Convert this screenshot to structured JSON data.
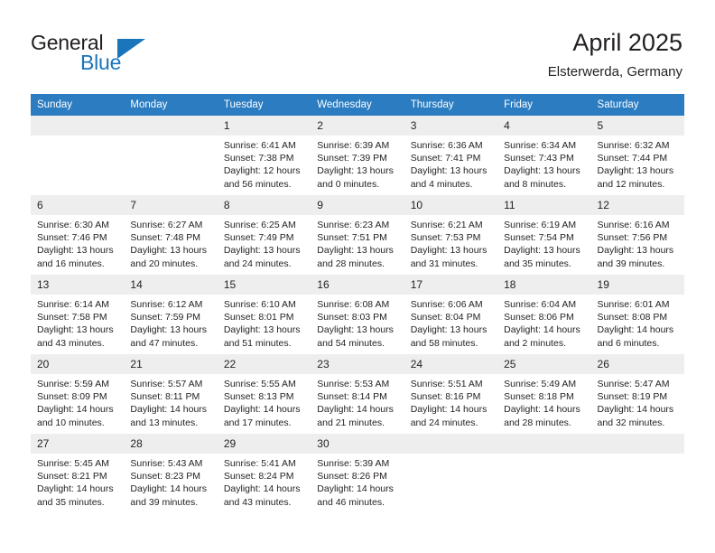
{
  "brand": {
    "word1": "General",
    "word2": "Blue",
    "logo_icon": "triangle-logo-icon",
    "accent_color": "#1b75bb"
  },
  "header": {
    "title": "April 2025",
    "subtitle": "Elsterwerda, Germany"
  },
  "calendar": {
    "header_bg": "#2b7cc1",
    "row_divider_color": "#2b6cb0",
    "daynum_bg": "#eeeeee",
    "weekday_headers": [
      "Sunday",
      "Monday",
      "Tuesday",
      "Wednesday",
      "Thursday",
      "Friday",
      "Saturday"
    ],
    "weeks": [
      [
        {
          "day": "",
          "sunrise": "",
          "sunset": "",
          "daylight_line1": "",
          "daylight_line2": ""
        },
        {
          "day": "",
          "sunrise": "",
          "sunset": "",
          "daylight_line1": "",
          "daylight_line2": ""
        },
        {
          "day": "1",
          "sunrise": "Sunrise: 6:41 AM",
          "sunset": "Sunset: 7:38 PM",
          "daylight_line1": "Daylight: 12 hours",
          "daylight_line2": "and 56 minutes."
        },
        {
          "day": "2",
          "sunrise": "Sunrise: 6:39 AM",
          "sunset": "Sunset: 7:39 PM",
          "daylight_line1": "Daylight: 13 hours",
          "daylight_line2": "and 0 minutes."
        },
        {
          "day": "3",
          "sunrise": "Sunrise: 6:36 AM",
          "sunset": "Sunset: 7:41 PM",
          "daylight_line1": "Daylight: 13 hours",
          "daylight_line2": "and 4 minutes."
        },
        {
          "day": "4",
          "sunrise": "Sunrise: 6:34 AM",
          "sunset": "Sunset: 7:43 PM",
          "daylight_line1": "Daylight: 13 hours",
          "daylight_line2": "and 8 minutes."
        },
        {
          "day": "5",
          "sunrise": "Sunrise: 6:32 AM",
          "sunset": "Sunset: 7:44 PM",
          "daylight_line1": "Daylight: 13 hours",
          "daylight_line2": "and 12 minutes."
        }
      ],
      [
        {
          "day": "6",
          "sunrise": "Sunrise: 6:30 AM",
          "sunset": "Sunset: 7:46 PM",
          "daylight_line1": "Daylight: 13 hours",
          "daylight_line2": "and 16 minutes."
        },
        {
          "day": "7",
          "sunrise": "Sunrise: 6:27 AM",
          "sunset": "Sunset: 7:48 PM",
          "daylight_line1": "Daylight: 13 hours",
          "daylight_line2": "and 20 minutes."
        },
        {
          "day": "8",
          "sunrise": "Sunrise: 6:25 AM",
          "sunset": "Sunset: 7:49 PM",
          "daylight_line1": "Daylight: 13 hours",
          "daylight_line2": "and 24 minutes."
        },
        {
          "day": "9",
          "sunrise": "Sunrise: 6:23 AM",
          "sunset": "Sunset: 7:51 PM",
          "daylight_line1": "Daylight: 13 hours",
          "daylight_line2": "and 28 minutes."
        },
        {
          "day": "10",
          "sunrise": "Sunrise: 6:21 AM",
          "sunset": "Sunset: 7:53 PM",
          "daylight_line1": "Daylight: 13 hours",
          "daylight_line2": "and 31 minutes."
        },
        {
          "day": "11",
          "sunrise": "Sunrise: 6:19 AM",
          "sunset": "Sunset: 7:54 PM",
          "daylight_line1": "Daylight: 13 hours",
          "daylight_line2": "and 35 minutes."
        },
        {
          "day": "12",
          "sunrise": "Sunrise: 6:16 AM",
          "sunset": "Sunset: 7:56 PM",
          "daylight_line1": "Daylight: 13 hours",
          "daylight_line2": "and 39 minutes."
        }
      ],
      [
        {
          "day": "13",
          "sunrise": "Sunrise: 6:14 AM",
          "sunset": "Sunset: 7:58 PM",
          "daylight_line1": "Daylight: 13 hours",
          "daylight_line2": "and 43 minutes."
        },
        {
          "day": "14",
          "sunrise": "Sunrise: 6:12 AM",
          "sunset": "Sunset: 7:59 PM",
          "daylight_line1": "Daylight: 13 hours",
          "daylight_line2": "and 47 minutes."
        },
        {
          "day": "15",
          "sunrise": "Sunrise: 6:10 AM",
          "sunset": "Sunset: 8:01 PM",
          "daylight_line1": "Daylight: 13 hours",
          "daylight_line2": "and 51 minutes."
        },
        {
          "day": "16",
          "sunrise": "Sunrise: 6:08 AM",
          "sunset": "Sunset: 8:03 PM",
          "daylight_line1": "Daylight: 13 hours",
          "daylight_line2": "and 54 minutes."
        },
        {
          "day": "17",
          "sunrise": "Sunrise: 6:06 AM",
          "sunset": "Sunset: 8:04 PM",
          "daylight_line1": "Daylight: 13 hours",
          "daylight_line2": "and 58 minutes."
        },
        {
          "day": "18",
          "sunrise": "Sunrise: 6:04 AM",
          "sunset": "Sunset: 8:06 PM",
          "daylight_line1": "Daylight: 14 hours",
          "daylight_line2": "and 2 minutes."
        },
        {
          "day": "19",
          "sunrise": "Sunrise: 6:01 AM",
          "sunset": "Sunset: 8:08 PM",
          "daylight_line1": "Daylight: 14 hours",
          "daylight_line2": "and 6 minutes."
        }
      ],
      [
        {
          "day": "20",
          "sunrise": "Sunrise: 5:59 AM",
          "sunset": "Sunset: 8:09 PM",
          "daylight_line1": "Daylight: 14 hours",
          "daylight_line2": "and 10 minutes."
        },
        {
          "day": "21",
          "sunrise": "Sunrise: 5:57 AM",
          "sunset": "Sunset: 8:11 PM",
          "daylight_line1": "Daylight: 14 hours",
          "daylight_line2": "and 13 minutes."
        },
        {
          "day": "22",
          "sunrise": "Sunrise: 5:55 AM",
          "sunset": "Sunset: 8:13 PM",
          "daylight_line1": "Daylight: 14 hours",
          "daylight_line2": "and 17 minutes."
        },
        {
          "day": "23",
          "sunrise": "Sunrise: 5:53 AM",
          "sunset": "Sunset: 8:14 PM",
          "daylight_line1": "Daylight: 14 hours",
          "daylight_line2": "and 21 minutes."
        },
        {
          "day": "24",
          "sunrise": "Sunrise: 5:51 AM",
          "sunset": "Sunset: 8:16 PM",
          "daylight_line1": "Daylight: 14 hours",
          "daylight_line2": "and 24 minutes."
        },
        {
          "day": "25",
          "sunrise": "Sunrise: 5:49 AM",
          "sunset": "Sunset: 8:18 PM",
          "daylight_line1": "Daylight: 14 hours",
          "daylight_line2": "and 28 minutes."
        },
        {
          "day": "26",
          "sunrise": "Sunrise: 5:47 AM",
          "sunset": "Sunset: 8:19 PM",
          "daylight_line1": "Daylight: 14 hours",
          "daylight_line2": "and 32 minutes."
        }
      ],
      [
        {
          "day": "27",
          "sunrise": "Sunrise: 5:45 AM",
          "sunset": "Sunset: 8:21 PM",
          "daylight_line1": "Daylight: 14 hours",
          "daylight_line2": "and 35 minutes."
        },
        {
          "day": "28",
          "sunrise": "Sunrise: 5:43 AM",
          "sunset": "Sunset: 8:23 PM",
          "daylight_line1": "Daylight: 14 hours",
          "daylight_line2": "and 39 minutes."
        },
        {
          "day": "29",
          "sunrise": "Sunrise: 5:41 AM",
          "sunset": "Sunset: 8:24 PM",
          "daylight_line1": "Daylight: 14 hours",
          "daylight_line2": "and 43 minutes."
        },
        {
          "day": "30",
          "sunrise": "Sunrise: 5:39 AM",
          "sunset": "Sunset: 8:26 PM",
          "daylight_line1": "Daylight: 14 hours",
          "daylight_line2": "and 46 minutes."
        },
        {
          "day": "",
          "sunrise": "",
          "sunset": "",
          "daylight_line1": "",
          "daylight_line2": ""
        },
        {
          "day": "",
          "sunrise": "",
          "sunset": "",
          "daylight_line1": "",
          "daylight_line2": ""
        },
        {
          "day": "",
          "sunrise": "",
          "sunset": "",
          "daylight_line1": "",
          "daylight_line2": ""
        }
      ]
    ]
  }
}
